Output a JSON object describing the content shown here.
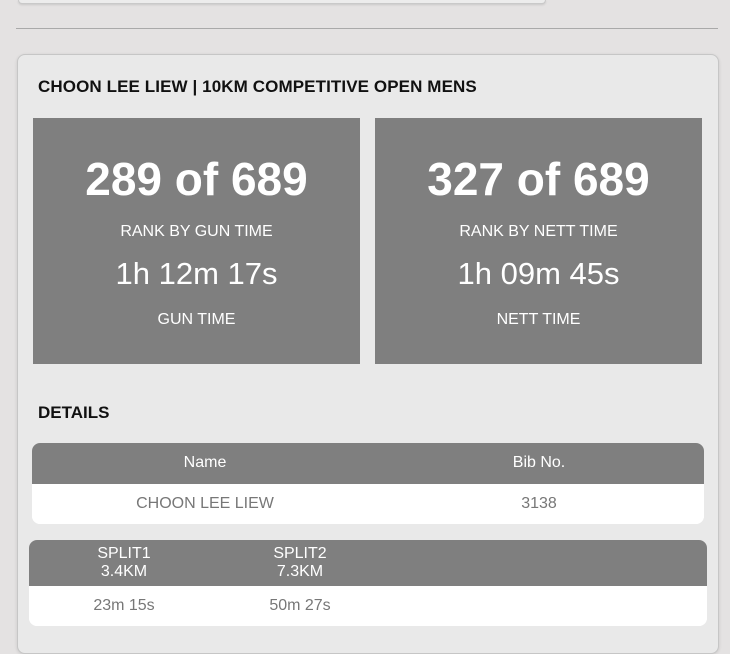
{
  "result": {
    "title": "CHOON LEE LIEW | 10KM COMPETITIVE OPEN MENS",
    "gun": {
      "rank": "289 of 689",
      "rank_label": "RANK BY GUN TIME",
      "time": "1h 12m 17s",
      "time_label": "GUN TIME"
    },
    "nett": {
      "rank": "327 of 689",
      "rank_label": "RANK BY NETT TIME",
      "time": "1h 09m 45s",
      "time_label": "NETT TIME"
    }
  },
  "details": {
    "heading": "DETAILS",
    "columns": [
      "Name",
      "Bib No."
    ],
    "row": [
      "CHOON LEE LIEW",
      "3138"
    ]
  },
  "splits": {
    "columns": [
      {
        "name": "SPLIT1",
        "distance": "3.4KM"
      },
      {
        "name": "SPLIT2",
        "distance": "7.3KM"
      }
    ],
    "row": [
      "23m 15s",
      "50m 27s"
    ]
  }
}
